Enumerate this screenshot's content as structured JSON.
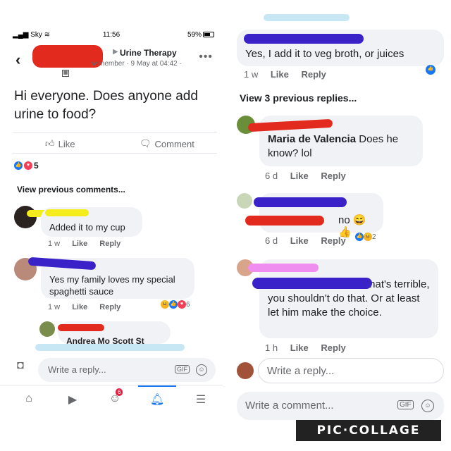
{
  "status_bar": {
    "carrier": "Sky",
    "time": "11:56",
    "battery": "59%"
  },
  "post": {
    "group": "Urine Therapy",
    "meta": "w member · 9 May at 04:42 ·",
    "text": "Hi everyone. Does anyone add urine to food?",
    "like_label": "Like",
    "comment_label": "Comment",
    "reaction_count": "5"
  },
  "left_comments": {
    "view_previous": "View previous comments...",
    "items": [
      {
        "text": "Added it to my cup",
        "age": "1 w",
        "like": "Like",
        "reply": "Reply"
      },
      {
        "text": "Yes my family loves my special spaghetti sauce",
        "age": "1 w",
        "like": "Like",
        "reply": "Reply",
        "reaction_count": "6"
      }
    ],
    "partial_name": "Andrea Mo Scott St"
  },
  "left_reply_bar": {
    "placeholder": "Write a reply...",
    "gif": "GIF"
  },
  "tabbar": {
    "notif_count": "6"
  },
  "right_comments": {
    "top_reply": {
      "text": "Yes, I add it to veg broth, or juices",
      "age": "1 w",
      "like": "Like",
      "reply": "Reply"
    },
    "view_previous": "View 3 previous replies...",
    "items": [
      {
        "name": "Maria de Valencia",
        "text": "Does he know? lol",
        "age": "6 d",
        "like": "Like",
        "reply": "Reply"
      },
      {
        "text": "no 😄👍",
        "age": "6 d",
        "like": "Like",
        "reply": "Reply",
        "reaction_count": "2"
      },
      {
        "text_suffix": "that's terrible, you shouldn't do that. Or at least let him make the choice.",
        "age": "1 h",
        "like": "Like",
        "reply": "Reply"
      }
    ]
  },
  "right_reply_bar": {
    "placeholder": "Write a reply..."
  },
  "right_comment_bar": {
    "placeholder": "Write a comment...",
    "gif": "GIF"
  },
  "watermark": "PIC·COLLAGE",
  "colors": {
    "fb_blue": "#1877f2",
    "bubble": "#f0f2f5",
    "redact_red": "#e22b1e",
    "redact_purple": "#3a22c9"
  }
}
